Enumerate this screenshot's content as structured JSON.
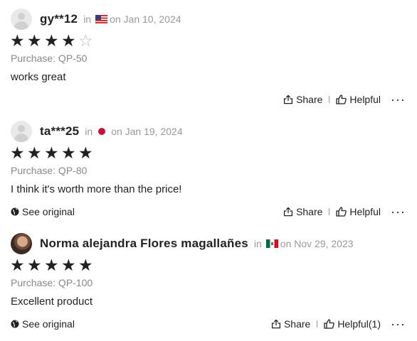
{
  "reviews": [
    {
      "username": "gy**12",
      "in_label": "in",
      "country_icon": "flag-us-icon",
      "date": "on Jan 10, 2024",
      "rating": 4,
      "purchase": "Purchase: QP-50",
      "text": "works great",
      "see_original": "",
      "share_label": "Share",
      "helpful_label": "Helpful",
      "more_label": "···"
    },
    {
      "username": "ta***25",
      "in_label": "in",
      "country_icon": "flag-jp-icon",
      "date": "on Jan 19, 2024",
      "rating": 5,
      "purchase": "Purchase: QP-80",
      "text": "I think it's worth more than the price!",
      "see_original": "See original",
      "share_label": "Share",
      "helpful_label": "Helpful",
      "more_label": "···"
    },
    {
      "username": "Norma alejandra Flores magallañes",
      "in_label": "in",
      "country_icon": "flag-mx-icon",
      "date": "on Nov 29, 2023",
      "rating": 5,
      "purchase": "Purchase: QP-100",
      "text": "Excellent product",
      "see_original": "See original",
      "share_label": "Share",
      "helpful_label": "Helpful(1)",
      "more_label": "···"
    }
  ],
  "colors": {
    "text": "#222222",
    "muted": "#999999",
    "star": "#222222",
    "star_empty": "#bbbbbb"
  }
}
